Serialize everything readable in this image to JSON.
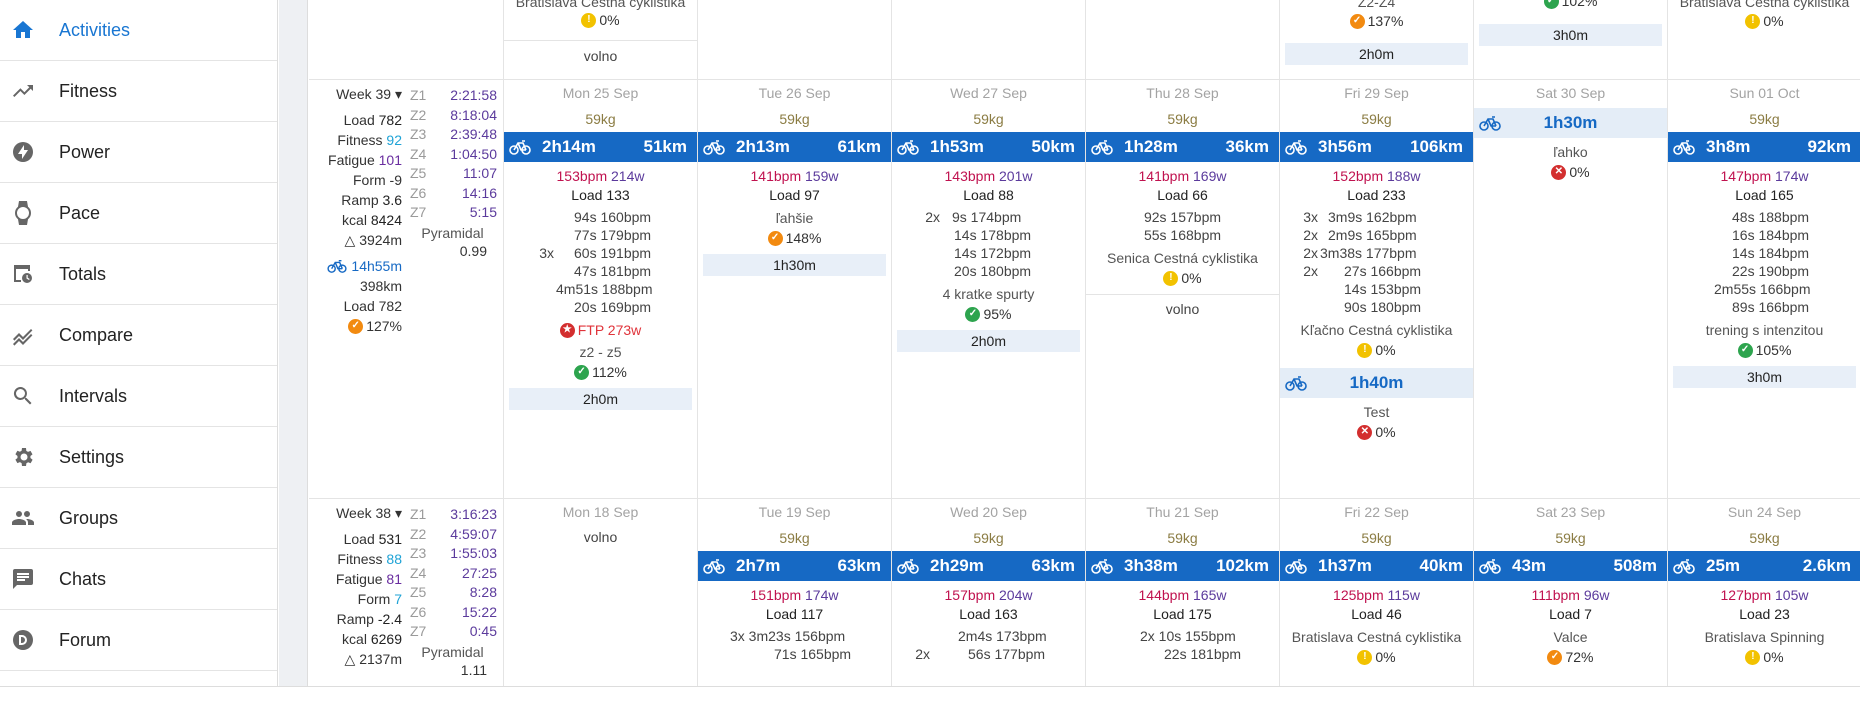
{
  "sidebar": {
    "items": [
      {
        "label": "Activities",
        "icon": "home-icon",
        "active": true
      },
      {
        "label": "Fitness",
        "icon": "trending-up-icon"
      },
      {
        "label": "Power",
        "icon": "lightning-icon"
      },
      {
        "label": "Pace",
        "icon": "watch-icon"
      },
      {
        "label": "Totals",
        "icon": "calendar-clock-icon"
      },
      {
        "label": "Compare",
        "icon": "compare-lines-icon"
      },
      {
        "label": "Intervals",
        "icon": "search-icon"
      },
      {
        "label": "Settings",
        "icon": "gear-icon"
      },
      {
        "label": "Groups",
        "icon": "people-icon"
      },
      {
        "label": "Chats",
        "icon": "chat-icon"
      },
      {
        "label": "Forum",
        "icon": "forum-icon"
      }
    ]
  },
  "top_partial": {
    "mon": {
      "title": "Bratislava Cestná cyklistika",
      "pct": "0%",
      "volno": "volno"
    },
    "fri": {
      "title": "Z2-Z4",
      "pct": "137%",
      "plan": "2h0m"
    },
    "sat": {
      "pct": "102%",
      "plan": "3h0m"
    },
    "sun": {
      "title": "Bratislava Cestná cyklistika",
      "pct": "0%"
    }
  },
  "week39": {
    "label": "Week 39",
    "stats": {
      "load_label": "Load",
      "load": "782",
      "fitness_label": "Fitness",
      "fitness": "92",
      "fatigue_label": "Fatigue",
      "fatigue": "101",
      "form": "Form -9",
      "ramp_label": "Ramp",
      "ramp": "3.6",
      "kcal_label": "kcal",
      "kcal": "8424",
      "elev": "△ 3924m",
      "ride_time": "14h55m",
      "ride_dist": "398km",
      "ride_load": "Load 782",
      "pct": "127%"
    },
    "zones": [
      {
        "z": "Z1",
        "t": "2:21:58"
      },
      {
        "z": "Z2",
        "t": "8:18:04"
      },
      {
        "z": "Z3",
        "t": "2:39:48"
      },
      {
        "z": "Z4",
        "t": "1:04:50"
      },
      {
        "z": "Z5",
        "t": "11:07"
      },
      {
        "z": "Z6",
        "t": "14:16"
      },
      {
        "z": "Z7",
        "t": "5:15"
      }
    ],
    "pyramidal_label": "Pyramidal",
    "pyramidal": "0.99",
    "days": [
      {
        "head": "Mon 25 Sep",
        "weight": "59kg",
        "dur": "2h14m",
        "dist": "51km",
        "hr": "153bpm",
        "pw": "214w",
        "load": "Load 133",
        "intervals": [
          [
            "",
            "94s 160bpm"
          ],
          [
            "",
            "77s 179bpm"
          ],
          [
            "3x",
            "60s 191bpm"
          ],
          [
            "",
            "47s 181bpm"
          ],
          [
            "",
            "4m51s 188bpm"
          ],
          [
            "",
            "20s 169bpm"
          ]
        ],
        "ftp": "FTP 273w",
        "title": "z2 - z5",
        "pct": "112%",
        "plan": "2h0m"
      },
      {
        "head": "Tue 26 Sep",
        "weight": "59kg",
        "dur": "2h13m",
        "dist": "61km",
        "hr": "141bpm",
        "pw": "159w",
        "load": "Load 97",
        "title": "ľahšie",
        "pct": "148%",
        "plan": "1h30m"
      },
      {
        "head": "Wed 27 Sep",
        "weight": "59kg",
        "dur": "1h53m",
        "dist": "50km",
        "hr": "143bpm",
        "pw": "201w",
        "load": "Load 88",
        "intervals": [
          [
            "2x",
            "9s 174bpm"
          ],
          [
            "",
            "14s 178bpm"
          ],
          [
            "",
            "14s 172bpm"
          ],
          [
            "",
            "20s 180bpm"
          ]
        ],
        "title": "4 kratke spurty",
        "pct": "95%",
        "plan": "2h0m"
      },
      {
        "head": "Thu 28 Sep",
        "weight": "59kg",
        "dur": "1h28m",
        "dist": "36km",
        "hr": "141bpm",
        "pw": "169w",
        "load": "Load 66",
        "intervals": [
          [
            "",
            "92s 157bpm"
          ],
          [
            "",
            "55s 168bpm"
          ]
        ],
        "title": "Senica Cestná cyklistika",
        "pct": "0%",
        "volno": "volno"
      },
      {
        "head": "Fri 29 Sep",
        "weight": "59kg",
        "dur": "3h56m",
        "dist": "106km",
        "hr": "152bpm",
        "pw": "188w",
        "load": "Load 233",
        "intervals": [
          [
            "3x",
            "3m9s 162bpm"
          ],
          [
            "2x",
            "2m9s 165bpm"
          ],
          [
            "2x",
            "3m38s 177bpm"
          ],
          [
            "2x",
            "27s 166bpm"
          ],
          [
            "",
            "14s 153bpm"
          ],
          [
            "",
            "90s 180bpm"
          ]
        ],
        "title": "Kľačno Cestná cyklistika",
        "pct": "0%",
        "dur2": "1h40m",
        "title2": "Test",
        "pct2": "0%"
      },
      {
        "head": "Sat 30 Sep",
        "dur": "1h30m",
        "title": "ľahko",
        "pct": "0%"
      },
      {
        "head": "Sun 01 Oct",
        "weight": "59kg",
        "dur": "3h8m",
        "dist": "92km",
        "hr": "147bpm",
        "pw": "174w",
        "load": "Load 165",
        "intervals": [
          [
            "",
            "48s 188bpm"
          ],
          [
            "",
            "16s 184bpm"
          ],
          [
            "",
            "14s 184bpm"
          ],
          [
            "",
            "22s 190bpm"
          ],
          [
            "",
            "2m55s 166bpm"
          ],
          [
            "",
            "89s 166bpm"
          ]
        ],
        "title": "trening s intenzitou",
        "pct": "105%",
        "plan": "3h0m"
      }
    ]
  },
  "week38": {
    "label": "Week 38",
    "stats": {
      "load_label": "Load",
      "load": "531",
      "fitness_label": "Fitness",
      "fitness": "88",
      "fatigue_label": "Fatigue",
      "fatigue": "81",
      "form": "Form 7",
      "ramp_label": "Ramp",
      "ramp": "-2.4",
      "kcal_label": "kcal",
      "kcal": "6269",
      "elev": "△ 2137m"
    },
    "zones": [
      {
        "z": "Z1",
        "t": "3:16:23"
      },
      {
        "z": "Z2",
        "t": "4:59:07"
      },
      {
        "z": "Z3",
        "t": "1:55:03"
      },
      {
        "z": "Z4",
        "t": "27:25"
      },
      {
        "z": "Z5",
        "t": "8:28"
      },
      {
        "z": "Z6",
        "t": "15:22"
      },
      {
        "z": "Z7",
        "t": "0:45"
      }
    ],
    "pyramidal_label": "Pyramidal",
    "pyramidal": "1.11",
    "days": [
      {
        "head": "Mon 18 Sep",
        "volno": "volno"
      },
      {
        "head": "Tue 19 Sep",
        "weight": "59kg",
        "dur": "2h7m",
        "dist": "63km",
        "hr": "151bpm",
        "pw": "174w",
        "load": "Load 117",
        "intervals": [
          [
            "",
            "3x 3m23s 156bpm"
          ],
          [
            "",
            "71s 165bpm"
          ]
        ]
      },
      {
        "head": "Wed 20 Sep",
        "weight": "59kg",
        "dur": "2h29m",
        "dist": "63km",
        "hr": "157bpm",
        "pw": "204w",
        "load": "Load 163",
        "intervals": [
          [
            "",
            "2m4s 173bpm"
          ],
          [
            "2x",
            "56s 177bpm"
          ]
        ]
      },
      {
        "head": "Thu 21 Sep",
        "weight": "59kg",
        "dur": "3h38m",
        "dist": "102km",
        "hr": "144bpm",
        "pw": "165w",
        "load": "Load 175",
        "intervals": [
          [
            "",
            "2x 10s 155bpm"
          ],
          [
            "",
            "22s 181bpm"
          ]
        ]
      },
      {
        "head": "Fri 22 Sep",
        "weight": "59kg",
        "dur": "1h37m",
        "dist": "40km",
        "hr": "125bpm",
        "pw": "115w",
        "load": "Load 46",
        "title": "Bratislava Cestná cyklistika",
        "pct": "0%"
      },
      {
        "head": "Sat 23 Sep",
        "weight": "59kg",
        "dur": "43m",
        "dist": "508m",
        "hr": "111bpm",
        "pw": "96w",
        "load": "Load 7",
        "title": "Valce",
        "pct": "72%"
      },
      {
        "head": "Sun 24 Sep",
        "weight": "59kg",
        "dur": "25m",
        "dist": "2.6km",
        "hr": "127bpm",
        "pw": "105w",
        "load": "Load 23",
        "title": "Bratislava Spinning",
        "pct": "0%"
      }
    ]
  }
}
